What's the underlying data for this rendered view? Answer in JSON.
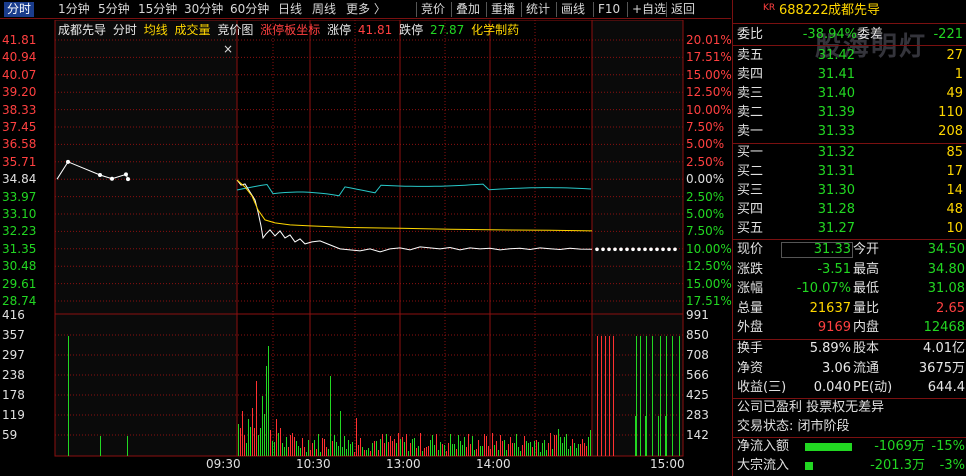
{
  "toolbar": {
    "left_items": [
      "分时",
      "1分钟",
      "5分钟",
      "15分钟",
      "30分钟",
      "60分钟",
      "日线",
      "周线",
      "更多 〉"
    ],
    "right_items": [
      "竞价",
      "叠加",
      "重播",
      "统计",
      "画线",
      "F10",
      "+自选",
      "返回"
    ],
    "active": "分时"
  },
  "chart": {
    "header": {
      "name": "成都先导",
      "period": "分时",
      "avg_label": "均线",
      "vol_label": "成交量",
      "auction_label": "竞价图",
      "limit_label": "涨停板坐标",
      "up_limit_label": "涨停",
      "up_limit_value": "41.81",
      "down_limit_label": "跌停",
      "down_limit_value": "27.87",
      "sector": "化学制药",
      "close_mark": "×"
    },
    "price_ticks": [
      "41.81",
      "40.94",
      "40.07",
      "39.20",
      "38.33",
      "37.45",
      "36.58",
      "35.71",
      "34.84",
      "33.97",
      "33.10",
      "32.23",
      "31.35",
      "30.48",
      "29.61",
      "28.74"
    ],
    "pct_ticks": [
      "20.01%",
      "17.51%",
      "15.00%",
      "12.50%",
      "10.00%",
      "7.50%",
      "5.00%",
      "2.50%",
      "0.00%",
      "2.50%",
      "5.00%",
      "7.50%",
      "10.00%",
      "12.50%",
      "15.00%",
      "17.51%"
    ],
    "vol_ticks_left": [
      "416",
      "357",
      "297",
      "238",
      "178",
      "119",
      "59"
    ],
    "vol_ticks_right": [
      "991",
      "850",
      "708",
      "566",
      "425",
      "283",
      "142"
    ],
    "time_ticks": [
      "09:30",
      "10:30",
      "13:00",
      "14:00",
      "15:00"
    ],
    "colors": {
      "price": "#ffffff",
      "avg": "#ffd700",
      "ratio": "#28c8c8",
      "up": "#ff3030",
      "down": "#22d722",
      "grid": "#8b1010"
    }
  },
  "panel": {
    "code": "688222",
    "name": "成都先导",
    "kr": "KR",
    "watermark": "股海明灯",
    "weibi_label": "委比",
    "weibi_value": "-38.94%",
    "weicha_label": "委差",
    "weicha_value": "-221",
    "asks": [
      {
        "label": "卖五",
        "price": "31.42",
        "vol": "27"
      },
      {
        "label": "卖四",
        "price": "31.41",
        "vol": "1"
      },
      {
        "label": "卖三",
        "price": "31.40",
        "vol": "49"
      },
      {
        "label": "卖二",
        "price": "31.39",
        "vol": "110"
      },
      {
        "label": "卖一",
        "price": "31.33",
        "vol": "208"
      }
    ],
    "bids": [
      {
        "label": "买一",
        "price": "31.32",
        "vol": "85"
      },
      {
        "label": "买二",
        "price": "31.31",
        "vol": "17"
      },
      {
        "label": "买三",
        "price": "31.30",
        "vol": "14"
      },
      {
        "label": "买四",
        "price": "31.28",
        "vol": "48"
      },
      {
        "label": "买五",
        "price": "31.27",
        "vol": "10"
      }
    ],
    "stats": [
      {
        "l1": "现价",
        "v1": "31.33",
        "c1": "g",
        "l2": "今开",
        "v2": "34.50",
        "c2": "g"
      },
      {
        "l1": "涨跌",
        "v1": "-3.51",
        "c1": "g",
        "l2": "最高",
        "v2": "34.80",
        "c2": "g"
      },
      {
        "l1": "涨幅",
        "v1": "-10.07%",
        "c1": "g",
        "l2": "最低",
        "v2": "31.08",
        "c2": "g"
      },
      {
        "l1": "总量",
        "v1": "21637",
        "c1": "y",
        "l2": "量比",
        "v2": "2.65",
        "c2": "r"
      },
      {
        "l1": "外盘",
        "v1": "9169",
        "c1": "r",
        "l2": "内盘",
        "v2": "12468",
        "c2": "g"
      }
    ],
    "stats2": [
      {
        "l1": "换手",
        "v1": "5.89%",
        "l2": "股本",
        "v2": "4.01亿"
      },
      {
        "l1": "净资",
        "v1": "3.06",
        "l2": "流通",
        "v2": "3675万"
      },
      {
        "l1": "收益(三)",
        "v1": "0.040",
        "l2": "PE(动)",
        "v2": "644.4"
      }
    ],
    "note": "公司已盈利 投票权无差异",
    "trade_status": "交易状态: 闭市阶段",
    "net_inflow_label": "净流入额",
    "net_inflow_value": "-1069万",
    "net_inflow_pct": "-15%",
    "block_inflow_label": "大宗流入",
    "block_inflow_value": "-201.3万",
    "block_inflow_pct": "-3%"
  }
}
